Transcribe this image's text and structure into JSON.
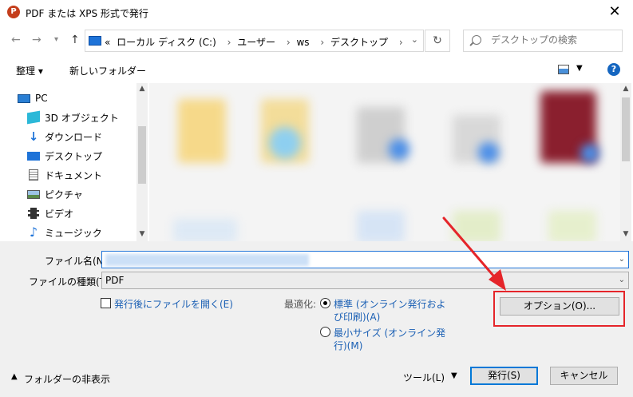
{
  "window": {
    "title": "PDF または XPS 形式で発行",
    "app_icon_letter": "P"
  },
  "nav": {
    "back_glyph": "←",
    "forward_glyph": "→",
    "up_glyph": "↑",
    "breadcrumbs": [
      "«",
      "ローカル ディスク (C:)",
      "ユーザー",
      "ws",
      "デスクトップ"
    ],
    "separator": "›",
    "refresh_glyph": "↻",
    "search_placeholder": "デスクトップの検索"
  },
  "toolbar": {
    "organize_label": "整理 ▾",
    "new_folder_label": "新しいフォルダー"
  },
  "sidebar": {
    "items": [
      {
        "label": "PC",
        "icon": "pc-icon"
      },
      {
        "label": "3D オブジェクト",
        "icon": "cube-icon"
      },
      {
        "label": "ダウンロード",
        "icon": "download-icon"
      },
      {
        "label": "デスクトップ",
        "icon": "desktop-icon"
      },
      {
        "label": "ドキュメント",
        "icon": "document-icon"
      },
      {
        "label": "ピクチャ",
        "icon": "picture-icon"
      },
      {
        "label": "ビデオ",
        "icon": "video-icon"
      },
      {
        "label": "ミュージック",
        "icon": "music-icon"
      }
    ]
  },
  "form": {
    "filename_label": "ファイル名(N):",
    "filetype_label": "ファイルの種類(T):",
    "filetype_value": "PDF",
    "open_after_label": "発行後にファイルを開く(E)",
    "optimize_label": "最適化:",
    "opt_standard_line1": "標準 (オンライン発行およ",
    "opt_standard_line2": "び印刷)(A)",
    "opt_min_line1": "最小サイズ (オンライン発",
    "opt_min_line2": "行)(M)",
    "options_button": "オプション(O)..."
  },
  "footer": {
    "hide_folders_label": "フォルダーの非表示",
    "tools_label": "ツール(L)",
    "publish_button": "発行(S)",
    "cancel_button": "キャンセル"
  },
  "colors": {
    "accent": "#0078d7",
    "annotation_red": "#e5252a",
    "link_blue": "#1a5fb4"
  }
}
